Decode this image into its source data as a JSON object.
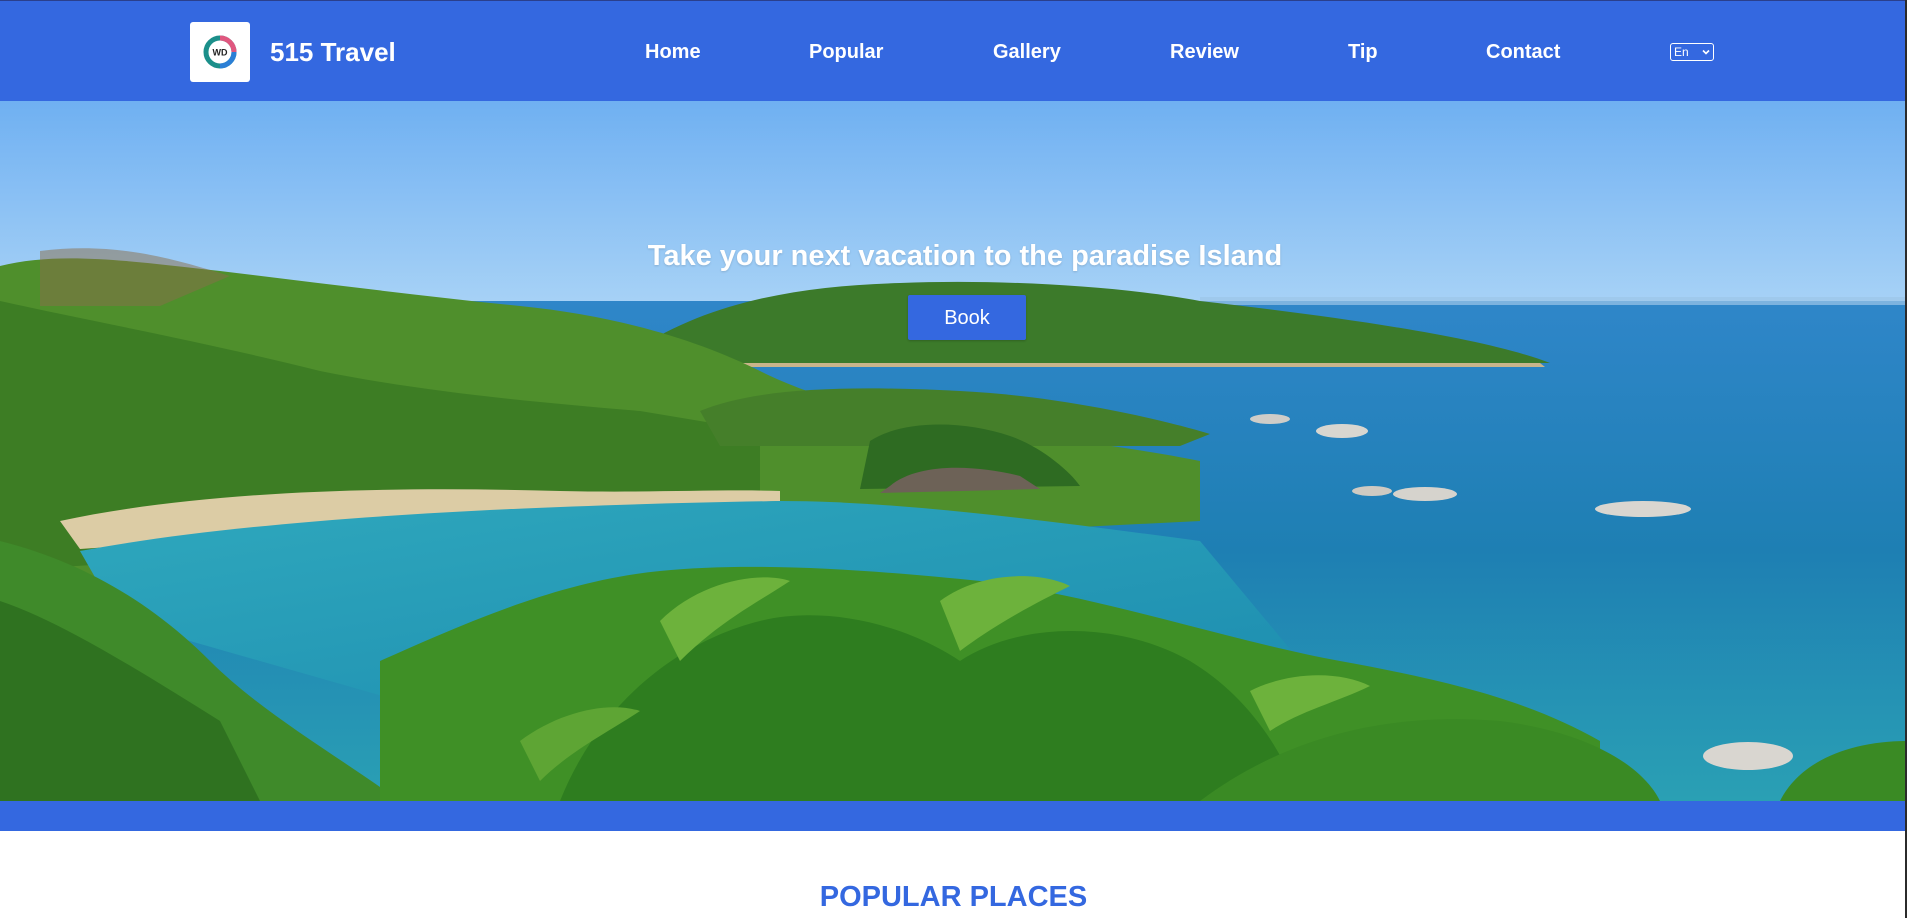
{
  "header": {
    "brand": "515 Travel",
    "logo_icon": "wd-swirl-logo-icon",
    "nav": [
      {
        "label": "Home"
      },
      {
        "label": "Popular"
      },
      {
        "label": "Gallery"
      },
      {
        "label": "Review"
      },
      {
        "label": "Tip"
      },
      {
        "label": "Contact"
      }
    ],
    "language": {
      "selected": "En",
      "icon": "chevron-down-icon"
    }
  },
  "hero": {
    "title": "Take your next vacation to the paradise Island",
    "button_label": "Book"
  },
  "popular": {
    "title": "POPULAR PLACES"
  },
  "colors": {
    "primary": "#3468e0",
    "text_on_primary": "#ffffff"
  }
}
